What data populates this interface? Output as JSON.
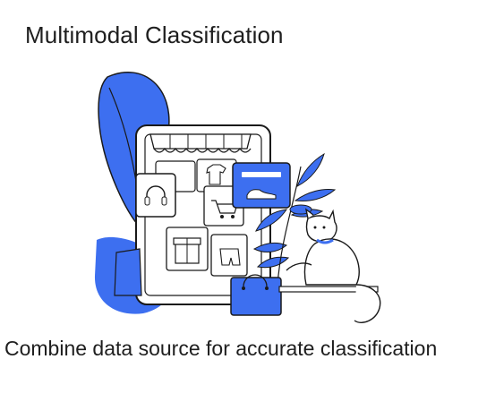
{
  "title": "Multimodal Classification",
  "caption": "Combine data source for accurate classification",
  "colors": {
    "accent": "#3d6ff0",
    "line": "#1a1a1a",
    "background": "#ffffff"
  },
  "illustration": {
    "icons": [
      "storefront-awning-icon",
      "headphones-icon",
      "tshirt-icon",
      "shopping-cart-icon",
      "sneaker-icon",
      "gift-box-icon",
      "shorts-icon",
      "shopping-bag-icon",
      "cat-icon",
      "leaf-icon"
    ]
  }
}
